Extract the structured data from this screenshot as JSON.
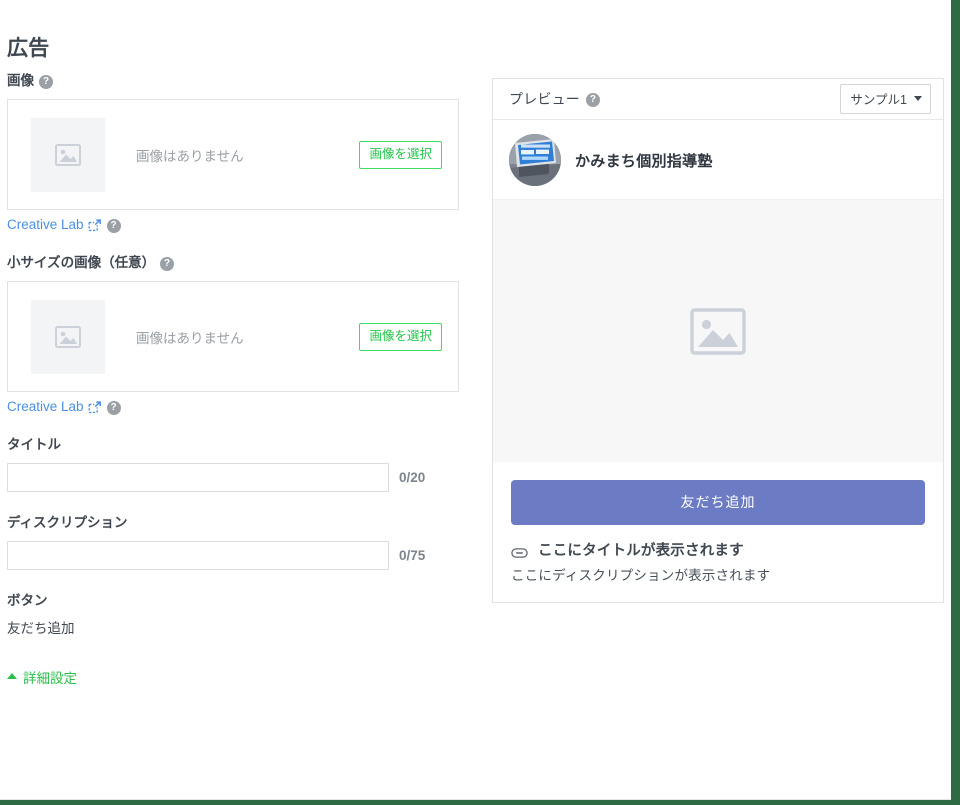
{
  "page": {
    "title": "広告"
  },
  "form": {
    "image_field": {
      "label": "画像",
      "help_icon": "help-circle-icon",
      "placeholder_icon": "image-placeholder-icon",
      "empty_text": "画像はありません",
      "select_button": "画像を選択",
      "creative_lab_link": "Creative Lab",
      "external_link_icon": "external-link-icon",
      "creative_lab_help_icon": "help-circle-icon"
    },
    "small_image_field": {
      "label": "小サイズの画像（任意）",
      "help_icon": "help-circle-icon",
      "placeholder_icon": "image-placeholder-icon",
      "empty_text": "画像はありません",
      "select_button": "画像を選択",
      "creative_lab_link": "Creative Lab",
      "external_link_icon": "external-link-icon",
      "creative_lab_help_icon": "help-circle-icon"
    },
    "title_field": {
      "label": "タイトル",
      "value": "",
      "placeholder": "",
      "counter": "0/20"
    },
    "description_field": {
      "label": "ディスクリプション",
      "value": "",
      "placeholder": "",
      "counter": "0/75"
    },
    "button_field": {
      "label": "ボタン",
      "value": "友だち追加"
    },
    "advanced_toggle": {
      "label": "詳細設定",
      "caret_icon": "caret-up-icon",
      "expanded": true
    }
  },
  "preview": {
    "header": {
      "title": "プレビュー",
      "help_icon": "help-circle-icon",
      "sample_select": {
        "value": "サンプル1",
        "caret_icon": "caret-down-icon"
      }
    },
    "profile": {
      "avatar_icon": "shop-avatar",
      "shop_name": "かみまち個別指導塾"
    },
    "image_placeholder_icon": "image-placeholder-icon",
    "cta_button": "友だち追加",
    "link_icon": "link-pill-icon",
    "ad_title": "ここにタイトルが表示されます",
    "ad_description": "ここにディスクリプションが表示されます"
  },
  "colors": {
    "accent_green": "#2fbe4e",
    "button_border_green": "#3ddc62",
    "link_blue": "#4a90e2",
    "cta_purple": "#6c7cc4",
    "chrome_green": "#2e6b45",
    "text_dark": "#3f4750",
    "text_muted": "#9aa0a6"
  }
}
